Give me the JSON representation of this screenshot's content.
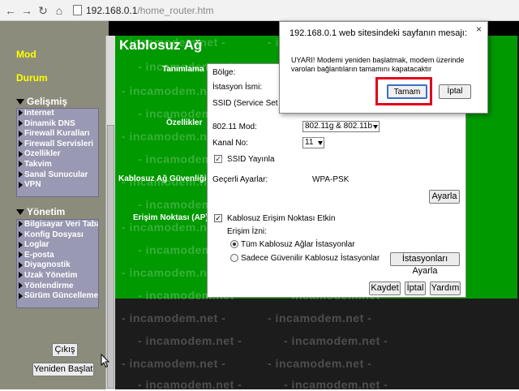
{
  "browser": {
    "address_scheme": "",
    "address_host": "192.168.0.1",
    "address_path": "/home_router.htm"
  },
  "nav": {
    "mode": "Mod",
    "status": "Durum",
    "advanced": "Gelişmiş",
    "advanced_items": [
      "Internet",
      "Dinamik DNS",
      "Firewall Kuralları",
      "Firewall Servisleri",
      "Özellikler",
      "Takvim",
      "Sanal Sunucular",
      "VPN"
    ],
    "management": "Yönetim",
    "management_items": [
      "Bilgisayar Veri Tabanı",
      "Konfig Dosyası",
      "Loglar",
      "E-posta",
      "Diyagnostik",
      "Uzak Yönetim",
      "Yönlendirme",
      "Sürüm Güncelleme"
    ],
    "logout_button": "Çıkış",
    "restart_button": "Yeniden Başlat"
  },
  "main": {
    "title": "Kablosuz Ağ",
    "section_identification": "Tanımlama",
    "region_label": "Bölge:",
    "station_name_label": "İstasyon İsmi:",
    "ssid_label": "SSID (Service Set Id",
    "section_features": "Özellikler",
    "mode_label": "802.11 Mod:",
    "mode_value": "802.11g & 802.11b",
    "channel_label": "Kanal No:",
    "channel_value": "11",
    "ssid_broadcast_label": "SSID Yayınla",
    "section_security": "Kablosuz Ağ Güvenliği",
    "current_settings_label": "Geçerli Ayarlar:",
    "current_settings_value": "WPA-PSK",
    "settings_button": "Ayarla",
    "section_ap": "Erişim Noktası (AP)",
    "ap_enabled_label": "Kablosuz Erişim Noktası Etkin",
    "access_permission_label": "Erişim İzni:",
    "all_stations_label": "Tüm Kablosuz Ağlar İstasyonlar",
    "trusted_stations_label": "Sadece Güvenilir Kablosuz İstasyonlar",
    "stations_settings_button": "İstasyonları Ayarla",
    "save_button": "Kaydet",
    "cancel_button": "İptal",
    "help_button": "Yardım"
  },
  "dialog": {
    "title": "192.168.0.1 web sitesindeki sayfanın mesajı:",
    "close": "×",
    "message": "UYARI! Modemi yeniden başlatmak, modem üzerinde varolan bağlantıların tamamını kapatacaktır",
    "ok_button": "Tamam",
    "cancel_button": "İptal"
  },
  "watermark": "- incamodem.net -",
  "colors": {
    "nav_yellow": "#ffff00",
    "green_panel": "#009900",
    "nav_box": "#9999b3",
    "highlight_red": "#e0001a"
  }
}
